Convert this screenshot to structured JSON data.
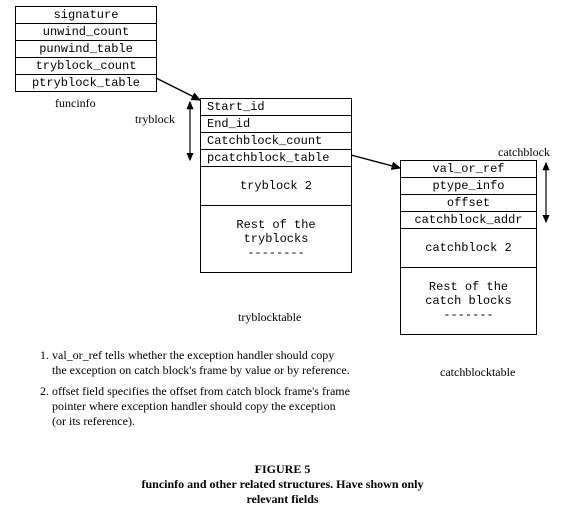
{
  "funcinfo": {
    "rows": [
      "signature",
      "unwind_count",
      "punwind_table",
      "tryblock_count",
      "ptryblock_table"
    ]
  },
  "tryblock": {
    "rows": [
      "Start_id",
      "End_id",
      "Catchblock_count",
      "pcatchblock_table"
    ],
    "slot2": "tryblock 2",
    "rest": "Rest of the\ntryblocks\n--------"
  },
  "catchblock": {
    "rows": [
      "val_or_ref",
      "ptype_info",
      "offset",
      "catchblock_addr"
    ],
    "slot2": "catchblock 2",
    "rest": "Rest of the\ncatch blocks\n-------"
  },
  "labels": {
    "funcinfo": "funcinfo",
    "tryblock": "tryblock",
    "tryblocktable": "tryblocktable",
    "catchblock": "catchblock",
    "catchblocktable": "catchblocktable"
  },
  "notes": {
    "n1": "val_or_ref tells whether the exception handler should copy the exception on catch block's frame by value or by reference.",
    "n2": "offset field  specifies the offset from catch block frame's frame pointer where exception handler should copy the exception  (or its reference)."
  },
  "caption": {
    "title": "FIGURE 5",
    "sub": "funcinfo and other related structures. Have shown only relevant fields"
  }
}
